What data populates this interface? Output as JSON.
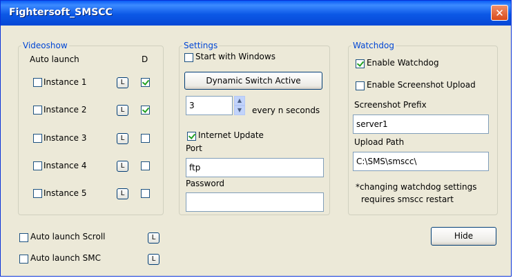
{
  "window": {
    "title": "Fightersoft_SMSCC",
    "close_glyph": "✕"
  },
  "videoshow": {
    "legend": "Videoshow",
    "auto_launch_header": "Auto launch",
    "d_header": "D",
    "instances": [
      {
        "label": "Instance 1",
        "auto_checked": false,
        "d_checked": true,
        "l_label": "L"
      },
      {
        "label": "Instance 2",
        "auto_checked": false,
        "d_checked": true,
        "l_label": "L"
      },
      {
        "label": "Instance 3",
        "auto_checked": false,
        "d_checked": false,
        "l_label": "L"
      },
      {
        "label": "Instance 4",
        "auto_checked": false,
        "d_checked": false,
        "l_label": "L"
      },
      {
        "label": "Instance 5",
        "auto_checked": false,
        "d_checked": false,
        "l_label": "L"
      }
    ]
  },
  "settings": {
    "legend": "Settings",
    "start_with_windows": {
      "label": "Start with Windows",
      "checked": false
    },
    "dynamic_switch_button": "Dynamic Switch Active",
    "interval_value": "3",
    "interval_suffix": "every n seconds",
    "internet_update": {
      "label": "Internet Update",
      "checked": true
    },
    "port_label": "Port",
    "port_value": "ftp",
    "password_label": "Password",
    "password_value": ""
  },
  "watchdog": {
    "legend": "Watchdog",
    "enable_watchdog": {
      "label": "Enable Watchdog",
      "checked": true
    },
    "enable_screenshot_upload": {
      "label": "Enable Screenshot Upload",
      "checked": false
    },
    "screenshot_prefix_label": "Screenshot Prefix",
    "screenshot_prefix_value": "server1",
    "upload_path_label": "Upload Path",
    "upload_path_value": "C:\\SMS\\smscc\\",
    "note_line1": "*changing watchdog settings",
    "note_line2": "requires smscc restart"
  },
  "bottom": {
    "auto_launch_scroll": {
      "label": "Auto launch Scroll",
      "checked": false,
      "l_label": "L"
    },
    "auto_launch_smc": {
      "label": "Auto launch SMC",
      "checked": false,
      "l_label": "L"
    },
    "hide_button": "Hide"
  }
}
